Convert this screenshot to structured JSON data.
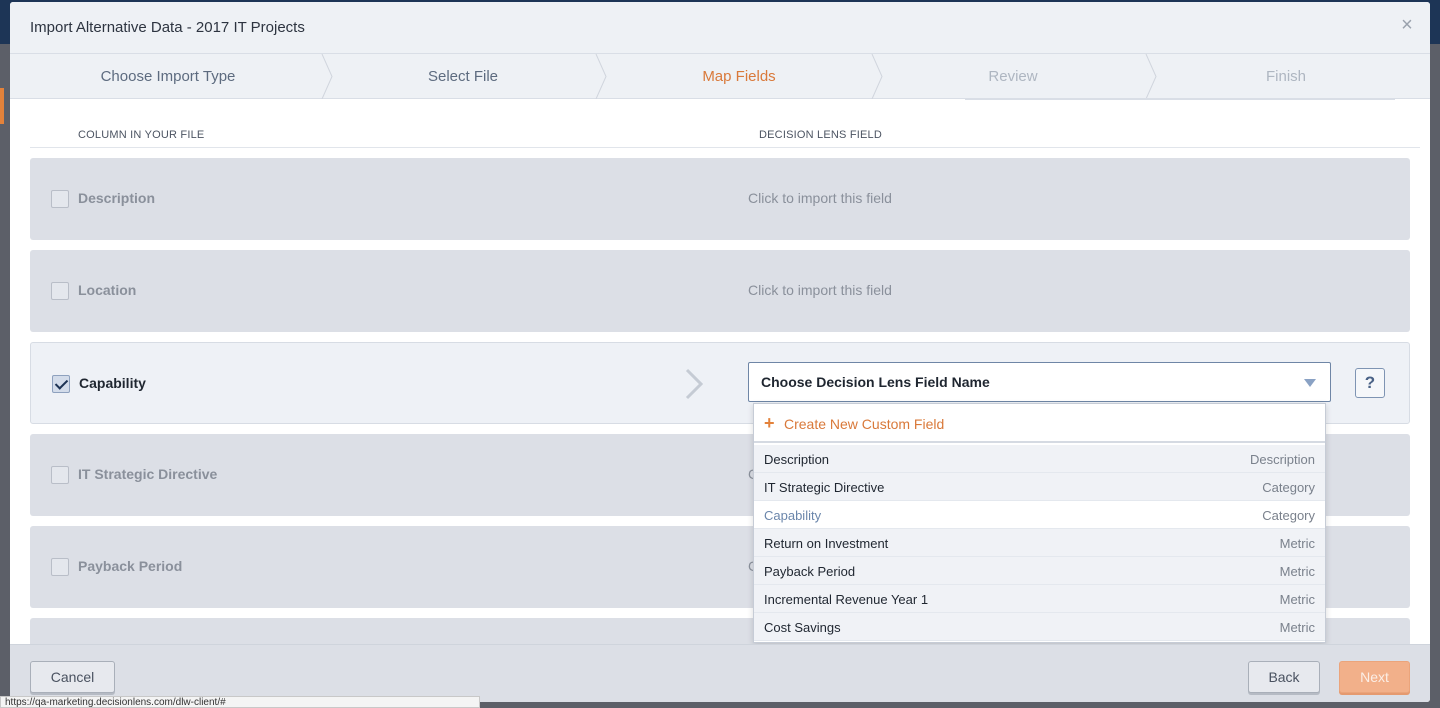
{
  "modal": {
    "title": "Import Alternative Data - 2017 IT Projects",
    "close_glyph": "×"
  },
  "wizard": {
    "steps": [
      {
        "label": "Choose Import Type",
        "state": "done"
      },
      {
        "label": "Select File",
        "state": "done"
      },
      {
        "label": "Map Fields",
        "state": "active"
      },
      {
        "label": "Review",
        "state": "future"
      },
      {
        "label": "Finish",
        "state": "future"
      }
    ]
  },
  "columns": {
    "file": "Column in your file",
    "lens": "Decision Lens Field"
  },
  "rows": [
    {
      "label": "Description",
      "checked": false,
      "hint": "Click to import this field"
    },
    {
      "label": "Location",
      "checked": false,
      "hint": "Click to import this field"
    },
    {
      "label": "Capability",
      "checked": true,
      "hint": ""
    },
    {
      "label": "IT Strategic Directive",
      "checked": false,
      "hint": "C"
    },
    {
      "label": "Payback Period",
      "checked": false,
      "hint": "C"
    }
  ],
  "field_select": {
    "label": "Choose Decision Lens Field Name",
    "help_glyph": "?"
  },
  "dropdown": {
    "create_glyph": "+",
    "create_label": "Create New Custom Field",
    "options": [
      {
        "name": "Description",
        "type": "Description"
      },
      {
        "name": "IT Strategic Directive",
        "type": "Category"
      },
      {
        "name": "Capability",
        "type": "Category"
      },
      {
        "name": "Return on Investment",
        "type": "Metric"
      },
      {
        "name": "Payback Period",
        "type": "Metric"
      },
      {
        "name": "Incremental Revenue Year 1",
        "type": "Metric"
      },
      {
        "name": "Cost Savings",
        "type": "Metric"
      }
    ],
    "highlighted_index": 2
  },
  "footer": {
    "cancel": "Cancel",
    "back": "Back",
    "next": "Next"
  },
  "status_bar": {
    "url": "https://qa-marketing.decisionlens.com/dlw-client/#"
  },
  "colors": {
    "accent": "#d9793a",
    "navy": "#1d3556",
    "select_border": "#6f86a6"
  }
}
